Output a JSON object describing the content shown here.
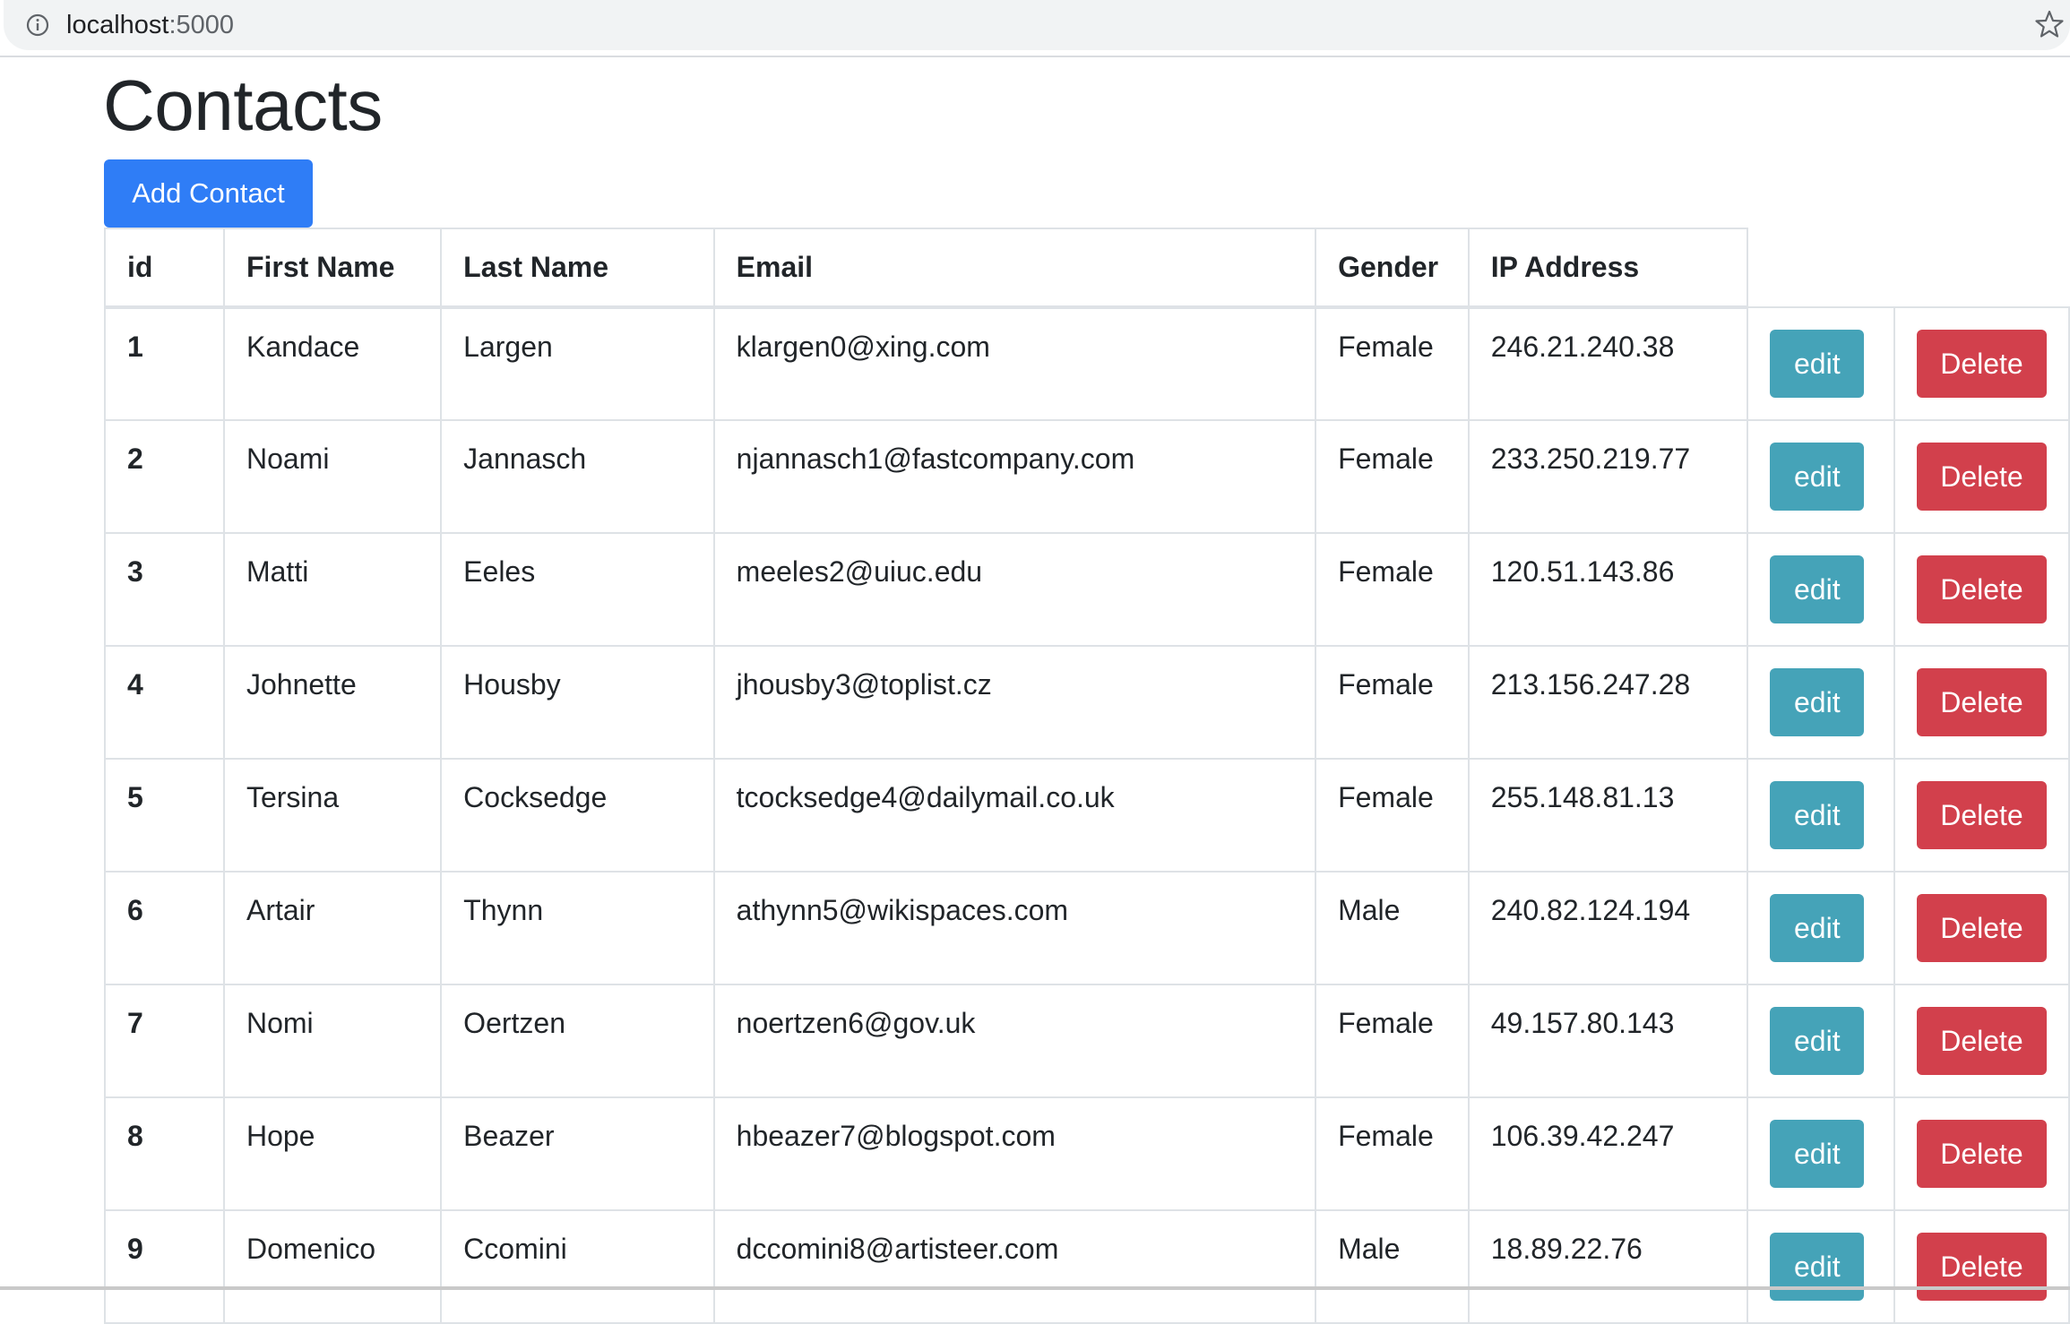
{
  "browser": {
    "url_host": "localhost",
    "url_port": ":5000"
  },
  "page": {
    "title": "Contacts",
    "add_button_label": "Add Contact"
  },
  "table": {
    "headers": [
      "id",
      "First Name",
      "Last Name",
      "Email",
      "Gender",
      "IP Address"
    ],
    "edit_label": "edit",
    "delete_label": "Delete",
    "rows": [
      {
        "id": "1",
        "first": "Kandace",
        "last": "Largen",
        "email": "klargen0@xing.com",
        "gender": "Female",
        "ip": "246.21.240.38"
      },
      {
        "id": "2",
        "first": "Noami",
        "last": "Jannasch",
        "email": "njannasch1@fastcompany.com",
        "gender": "Female",
        "ip": "233.250.219.77"
      },
      {
        "id": "3",
        "first": "Matti",
        "last": "Eeles",
        "email": "meeles2@uiuc.edu",
        "gender": "Female",
        "ip": "120.51.143.86"
      },
      {
        "id": "4",
        "first": "Johnette",
        "last": "Housby",
        "email": "jhousby3@toplist.cz",
        "gender": "Female",
        "ip": "213.156.247.28"
      },
      {
        "id": "5",
        "first": "Tersina",
        "last": "Cocksedge",
        "email": "tcocksedge4@dailymail.co.uk",
        "gender": "Female",
        "ip": "255.148.81.13"
      },
      {
        "id": "6",
        "first": "Artair",
        "last": "Thynn",
        "email": "athynn5@wikispaces.com",
        "gender": "Male",
        "ip": "240.82.124.194"
      },
      {
        "id": "7",
        "first": "Nomi",
        "last": "Oertzen",
        "email": "noertzen6@gov.uk",
        "gender": "Female",
        "ip": "49.157.80.143"
      },
      {
        "id": "8",
        "first": "Hope",
        "last": "Beazer",
        "email": "hbeazer7@blogspot.com",
        "gender": "Female",
        "ip": "106.39.42.247"
      },
      {
        "id": "9",
        "first": "Domenico",
        "last": "Ccomini",
        "email": "dccomini8@artisteer.com",
        "gender": "Male",
        "ip": "18.89.22.76"
      }
    ]
  },
  "icons": {
    "info": "info-icon",
    "bookmark": "star-icon"
  },
  "colors": {
    "primary": "#2f7df6",
    "info": "#45a3b8",
    "danger": "#d2404c"
  }
}
